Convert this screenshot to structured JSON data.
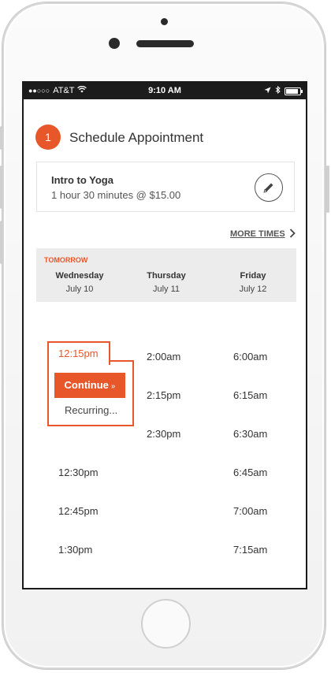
{
  "status": {
    "signal": "●●○○○",
    "carrier": "AT&T",
    "time": "9:10 AM"
  },
  "header": {
    "step": "1",
    "title": "Schedule Appointment"
  },
  "service": {
    "name": "Intro to Yoga",
    "detail": "1 hour 30 minutes @ $15.00"
  },
  "more_times": "MORE TIMES",
  "days": [
    {
      "tag": "TOMORROW",
      "name": "Wednesday",
      "date": "July 10"
    },
    {
      "tag": "",
      "name": "Thursday",
      "date": "July 11"
    },
    {
      "tag": "",
      "name": "Friday",
      "date": "July 12"
    }
  ],
  "selected": {
    "time": "12:15pm",
    "continue_label": "Continue",
    "continue_arrows": "»",
    "recurring_label": "Recurring..."
  },
  "slots": {
    "wednesday": [
      "12:30pm",
      "12:45pm",
      "1:30pm"
    ],
    "thursday": [
      "2:00am",
      "2:15pm",
      "2:30pm"
    ],
    "friday": [
      "6:00am",
      "6:15am",
      "6:30am",
      "6:45am",
      "7:00am",
      "7:15am"
    ]
  },
  "colors": {
    "accent": "#e8572a"
  }
}
